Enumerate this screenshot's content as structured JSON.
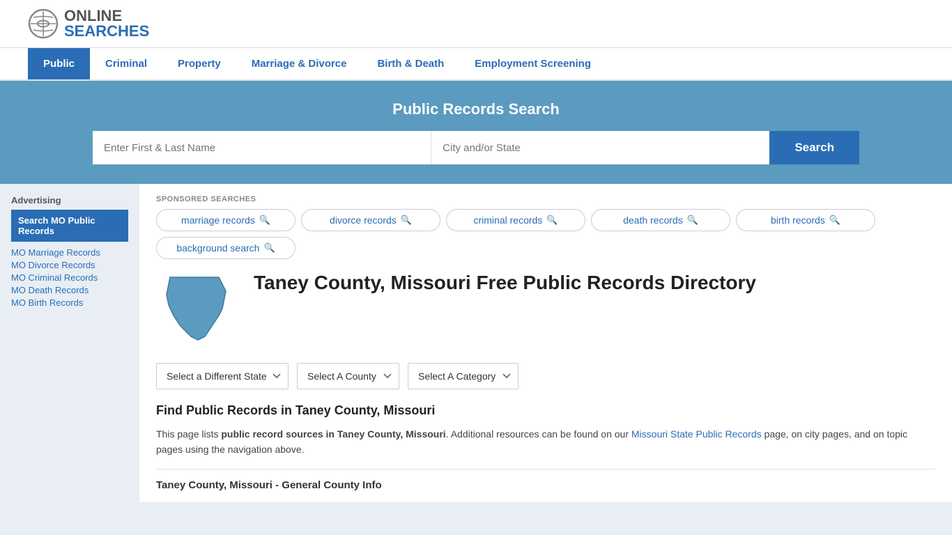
{
  "logo": {
    "online": "ONLINE",
    "searches": "SEARCHES"
  },
  "nav": {
    "items": [
      {
        "label": "Public",
        "active": true
      },
      {
        "label": "Criminal",
        "active": false
      },
      {
        "label": "Property",
        "active": false
      },
      {
        "label": "Marriage & Divorce",
        "active": false
      },
      {
        "label": "Birth & Death",
        "active": false
      },
      {
        "label": "Employment Screening",
        "active": false
      }
    ]
  },
  "search_banner": {
    "title": "Public Records Search",
    "name_placeholder": "Enter First & Last Name",
    "location_placeholder": "City and/or State",
    "button_label": "Search"
  },
  "sponsored": {
    "label": "SPONSORED SEARCHES",
    "tags": [
      {
        "label": "marriage records"
      },
      {
        "label": "divorce records"
      },
      {
        "label": "criminal records"
      },
      {
        "label": "death records"
      },
      {
        "label": "birth records"
      },
      {
        "label": "background search"
      }
    ]
  },
  "sidebar": {
    "ad_label": "Advertising",
    "highlight_label": "Search MO Public Records",
    "links": [
      {
        "label": "MO Marriage Records"
      },
      {
        "label": "MO Divorce Records"
      },
      {
        "label": "MO Criminal Records"
      },
      {
        "label": "MO Death Records"
      },
      {
        "label": "MO Birth Records"
      }
    ]
  },
  "location": {
    "title": "Taney County, Missouri Free Public Records Directory",
    "dropdowns": {
      "state": "Select a Different State",
      "county": "Select A County",
      "category": "Select A Category"
    },
    "find_title": "Find Public Records in Taney County, Missouri",
    "find_description_part1": "This page lists ",
    "find_description_bold": "public record sources in Taney County, Missouri",
    "find_description_part2": ". Additional resources can be found on our ",
    "find_description_link": "Missouri State Public Records",
    "find_description_part3": " page, on city pages, and on topic pages using the navigation above.",
    "county_section_title": "Taney County, Missouri - General County Info"
  }
}
